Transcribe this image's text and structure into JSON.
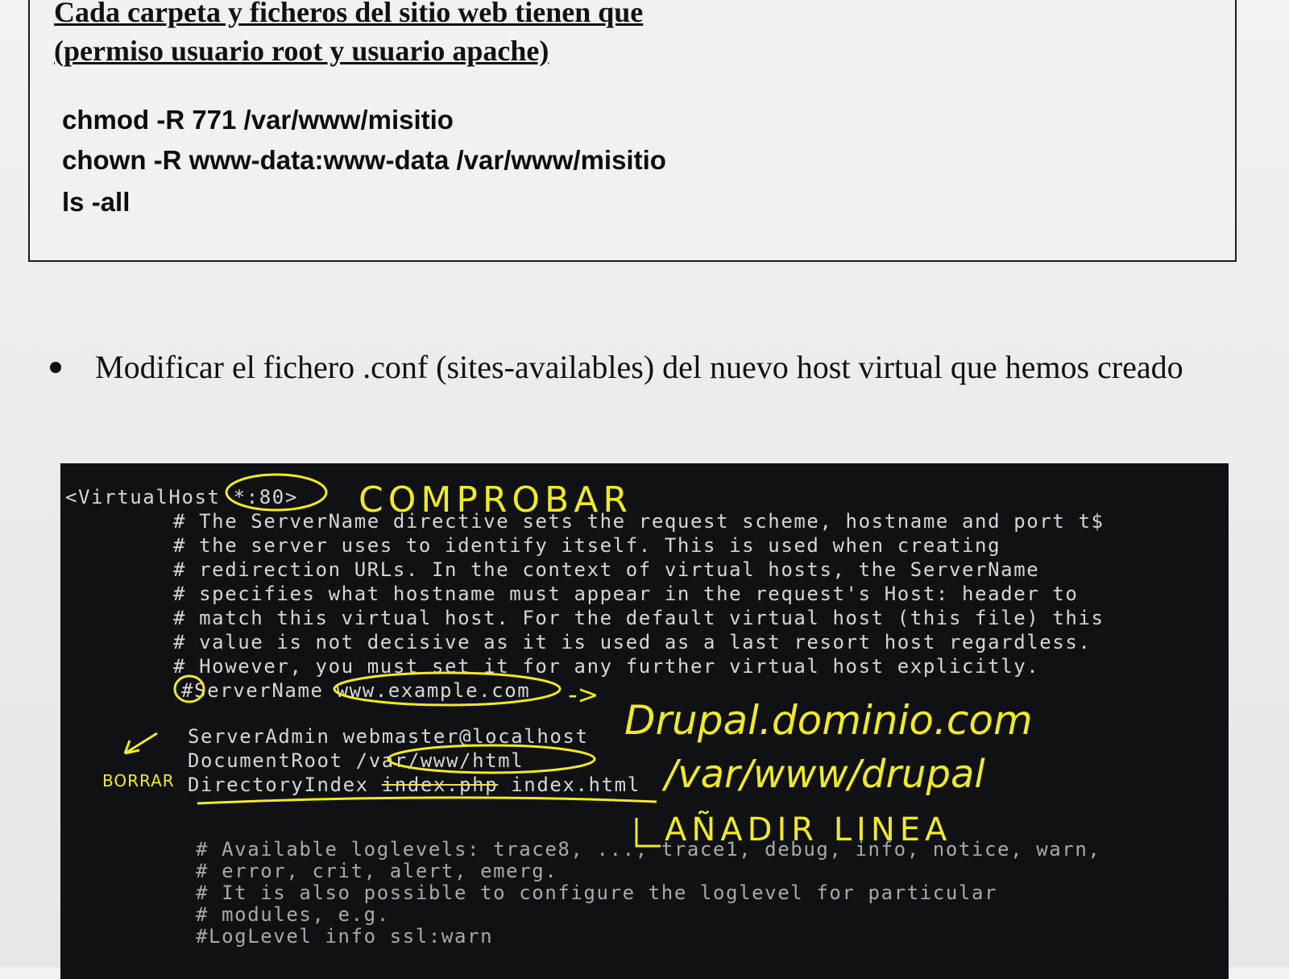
{
  "document": {
    "box_heading_line1": "Cada carpeta y ficheros del sitio web tienen que",
    "box_heading_line2": "(permiso usuario root y usuario apache)",
    "commands": [
      "chmod -R 771 /var/www/misitio",
      "chown -R www-data:www-data  /var/www/misitio",
      "ls -all"
    ],
    "bullet_text": "Modificar el fichero .conf (sites-availables) del nuevo host virtual que hemos creado"
  },
  "terminal": {
    "virtualhost_open": "<VirtualHost *:80>",
    "comment_lines": [
      "# The ServerName directive sets the request scheme, hostname and port t$",
      "# the server uses to identify itself. This is used when creating",
      "# redirection URLs. In the context of virtual hosts, the ServerName",
      "# specifies what hostname must appear in the request's Host: header to",
      "# match this virtual host. For the default virtual host (this file) this",
      "# value is not decisive as it is used as a last resort host regardless.",
      "# However, you must set it for any further virtual host explicitly."
    ],
    "servername_line": "#ServerName www.example.com",
    "serveradmin_line": "ServerAdmin webmaster@localhost",
    "documentroot_line": "DocumentRoot /var/www/html",
    "directoryindex_prefix": "DirectoryIndex ",
    "directoryindex_struck": "index.php",
    "directoryindex_suffix": " index.html",
    "loglevel_lines": [
      "# Available loglevels: trace8, ..., trace1, debug, info, notice, warn,",
      "# error, crit, alert, emerg.",
      "# It is also possible to configure the loglevel for particular",
      "# modules, e.g.",
      "#LogLevel info ssl:warn"
    ]
  },
  "annotations": {
    "comprobar": "COMPROBAR",
    "server_name_note": "Drupal.dominio.com",
    "document_root_note": "/var/www/drupal",
    "borrar": "BORRAR",
    "anadir_linea": "AÑADIR LINEA",
    "arrow": "->",
    "ink_color": "#f2ea25"
  }
}
